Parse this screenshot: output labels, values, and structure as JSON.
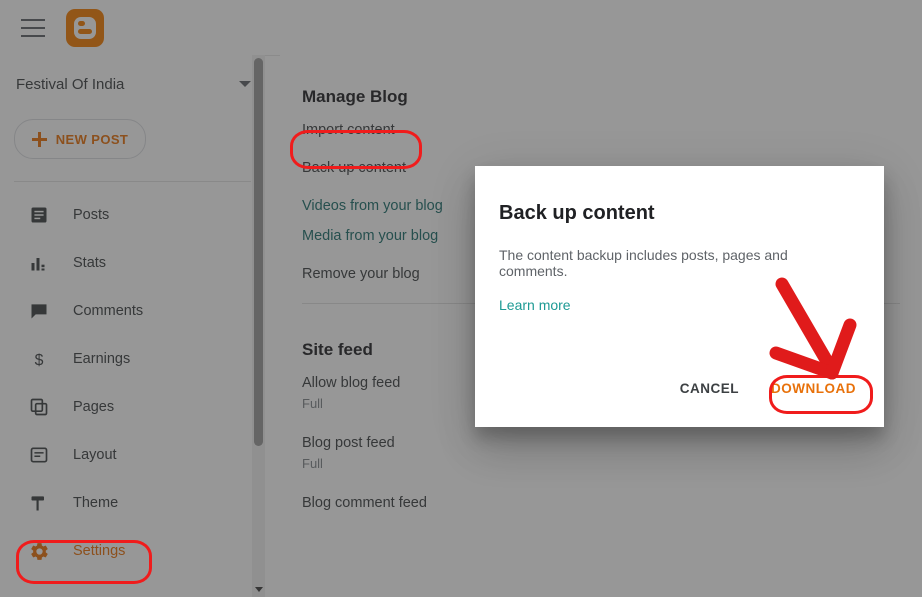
{
  "topbar": {
    "menu_icon": "hamburger-menu-icon",
    "logo_icon": "blogger-logo-icon",
    "logo_color": "#f57d00"
  },
  "sidebar": {
    "blog_name": "Festival Of India",
    "blog_picker_icon": "chevron-down-icon",
    "new_post_label": "NEW POST",
    "new_post_icon": "plus-icon",
    "accent_color": "#e8710a",
    "items": [
      {
        "label": "Posts",
        "icon": "posts-icon",
        "active": false
      },
      {
        "label": "Stats",
        "icon": "stats-icon",
        "active": false
      },
      {
        "label": "Comments",
        "icon": "comments-icon",
        "active": false
      },
      {
        "label": "Earnings",
        "icon": "earnings-icon",
        "active": false
      },
      {
        "label": "Pages",
        "icon": "pages-icon",
        "active": false
      },
      {
        "label": "Layout",
        "icon": "layout-icon",
        "active": false
      },
      {
        "label": "Theme",
        "icon": "theme-icon",
        "active": false
      },
      {
        "label": "Settings",
        "icon": "settings-gear-icon",
        "active": true
      }
    ]
  },
  "main": {
    "manage_blog": {
      "title": "Manage Blog",
      "rows": [
        {
          "label": "Import content",
          "value": "",
          "link": false
        },
        {
          "label": "Back up content",
          "value": "",
          "link": false
        },
        {
          "label": "Videos from your blog",
          "value": "",
          "link": true
        },
        {
          "label": "Media from your blog",
          "value": "",
          "link": true
        },
        {
          "label": "Remove your blog",
          "value": "",
          "link": false
        }
      ]
    },
    "site_feed": {
      "title": "Site feed",
      "rows": [
        {
          "label": "Allow blog feed",
          "value": "Full"
        },
        {
          "label": "Blog post feed",
          "value": "Full"
        },
        {
          "label": "Blog comment feed",
          "value": ""
        }
      ]
    }
  },
  "dialog": {
    "title": "Back up content",
    "body": "The content backup includes posts, pages and comments.",
    "learn_more": "Learn more",
    "cancel_label": "CANCEL",
    "download_label": "DOWNLOAD"
  },
  "annotations": {
    "color": "#f01c1c",
    "import_content_highlight": "Import content",
    "settings_highlight": "Settings",
    "download_highlight": "DOWNLOAD",
    "arrow": "red-arrow-pointing-to-download"
  }
}
